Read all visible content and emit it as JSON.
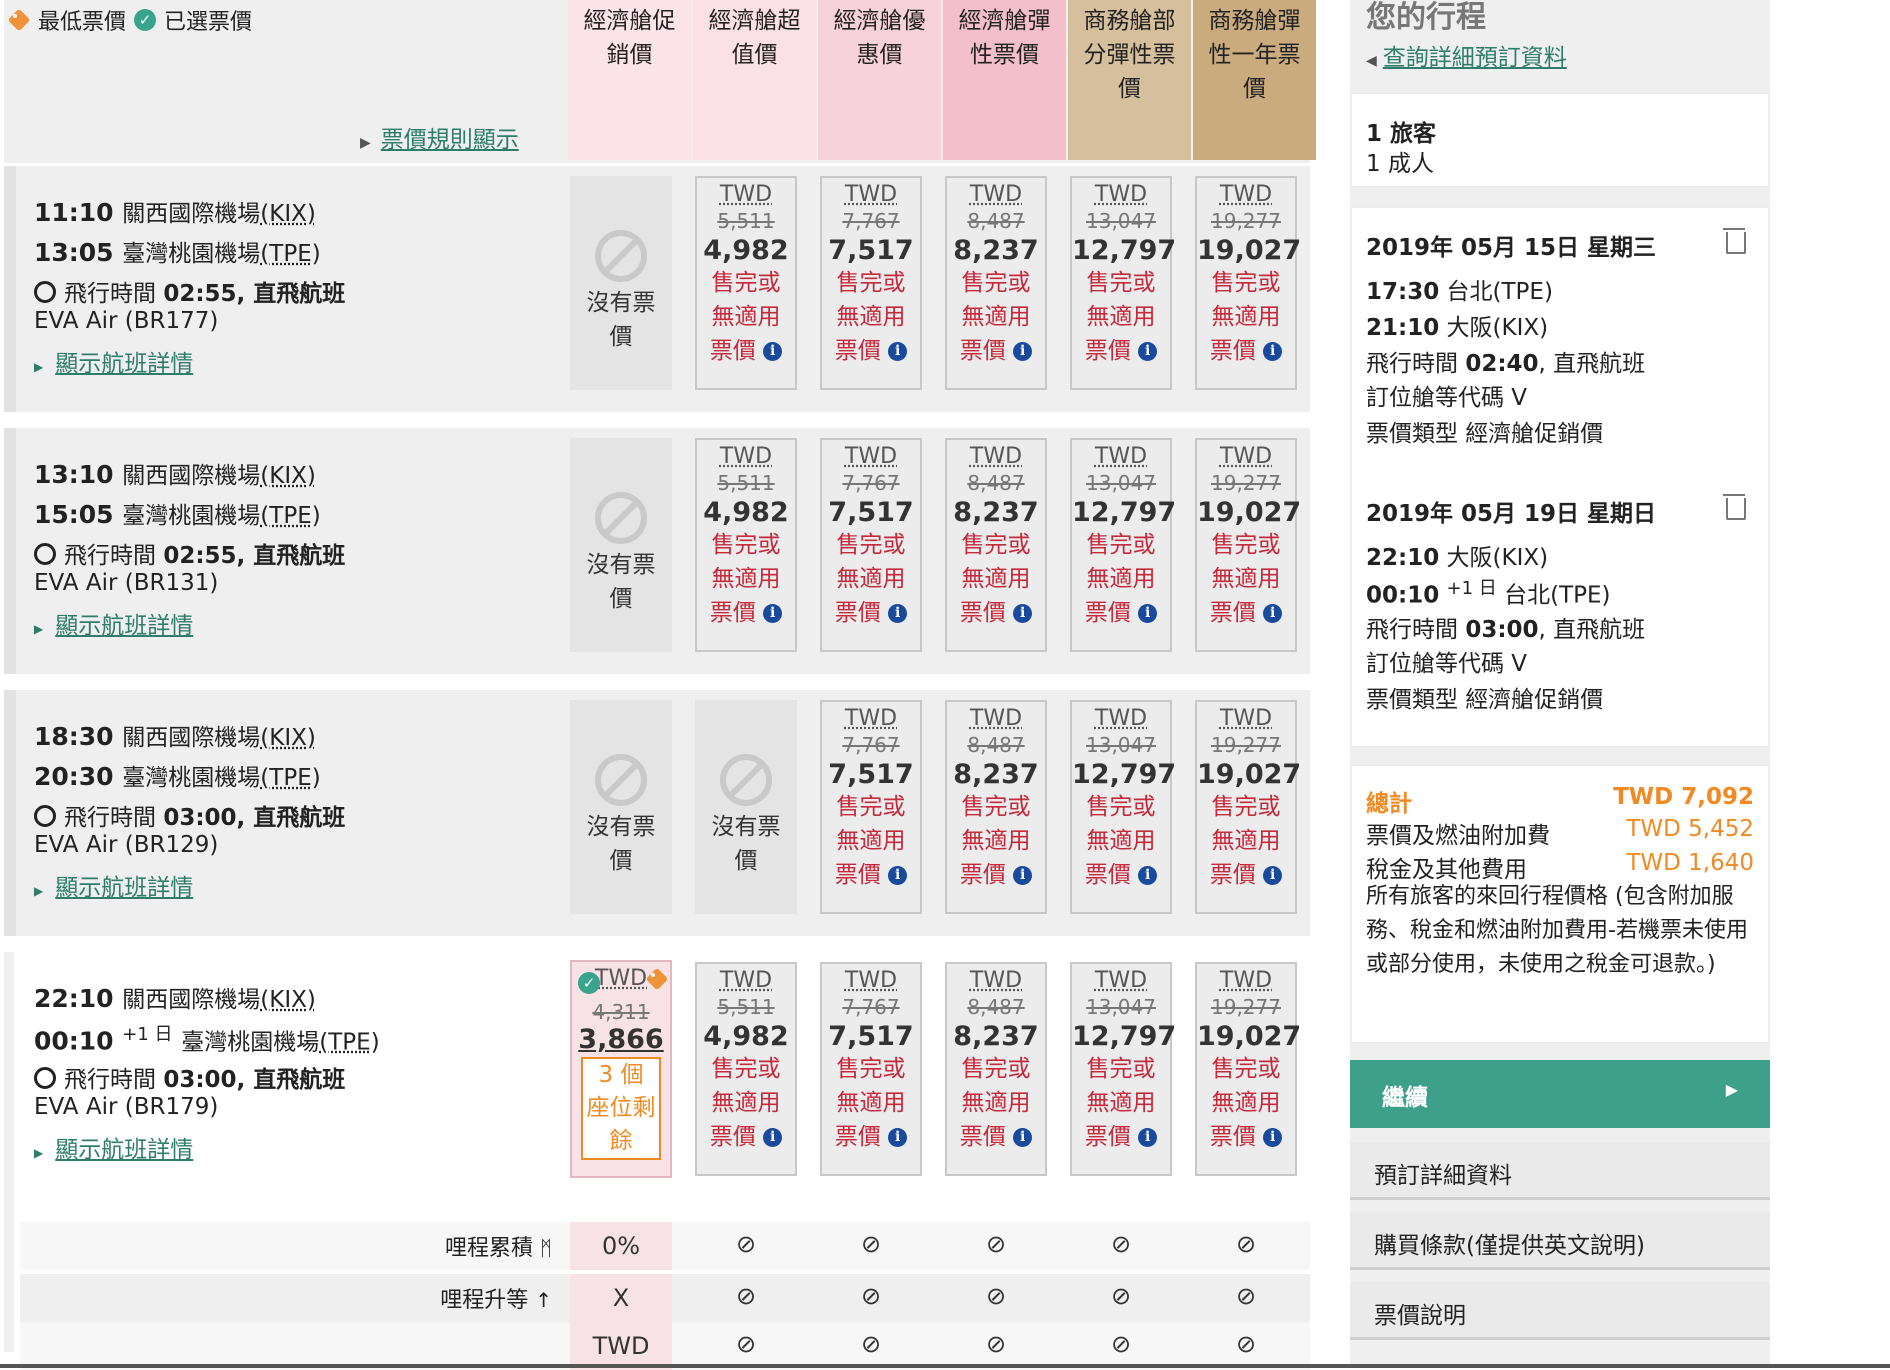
{
  "legend": {
    "lowest": "最低票價",
    "selected": "已選票價"
  },
  "rules_link": "票價規則顯示",
  "columns": [
    {
      "label": "經濟艙促銷價",
      "lines": [
        "經濟艙促",
        "銷價"
      ],
      "color": "#fce4e9"
    },
    {
      "label": "經濟艙超值價",
      "lines": [
        "經濟艙超",
        "值價"
      ],
      "color": "#fbe0e6"
    },
    {
      "label": "經濟艙優惠價",
      "lines": [
        "經濟艙優",
        "惠價"
      ],
      "color": "#f8d2da"
    },
    {
      "label": "經濟艙彈性票價",
      "lines": [
        "經濟艙彈",
        "性票價"
      ],
      "color": "#f3bfcb"
    },
    {
      "label": "商務艙部分彈性票價",
      "lines": [
        "商務艙部",
        "分彈性票",
        "價"
      ],
      "color": "#d6bf9d"
    },
    {
      "label": "商務艙彈性一年票價",
      "lines": [
        "商務艙彈",
        "性一年票",
        "價"
      ],
      "color": "#c9ab7d"
    }
  ],
  "labels": {
    "currency": "TWD",
    "no_price_1": "沒有票",
    "no_price_2": "價",
    "na_1": "售完或",
    "na_2": "無適用",
    "na_3": "票價",
    "duration_prefix": "飛行時間",
    "direct": ", 直飛航班",
    "details": "顯示航班詳情",
    "plus_day": "+1 日",
    "seats_1": "3 個",
    "seats_2": "座位剩",
    "seats_3": "餘"
  },
  "flights": [
    {
      "dep_time": "11:10",
      "dep_airport": "關西國際機場",
      "dep_code": "(KIX)",
      "arr_time": "13:05",
      "arr_airport": "臺灣桃園機場",
      "arr_code": "(TPE)",
      "duration": "02:55",
      "airline": "EVA Air (BR177)",
      "fares": [
        null,
        {
          "old": "5,511",
          "new": "4,982"
        },
        {
          "old": "7,767",
          "new": "7,517"
        },
        {
          "old": "8,487",
          "new": "8,237"
        },
        {
          "old": "13,047",
          "new": "12,797"
        },
        {
          "old": "19,277",
          "new": "19,027"
        }
      ]
    },
    {
      "dep_time": "13:10",
      "dep_airport": "關西國際機場",
      "dep_code": "(KIX)",
      "arr_time": "15:05",
      "arr_airport": "臺灣桃園機場",
      "arr_code": "(TPE)",
      "duration": "02:55",
      "airline": "EVA Air (BR131)",
      "fares": [
        null,
        {
          "old": "5,511",
          "new": "4,982"
        },
        {
          "old": "7,767",
          "new": "7,517"
        },
        {
          "old": "8,487",
          "new": "8,237"
        },
        {
          "old": "13,047",
          "new": "12,797"
        },
        {
          "old": "19,277",
          "new": "19,027"
        }
      ]
    },
    {
      "dep_time": "18:30",
      "dep_airport": "關西國際機場",
      "dep_code": "(KIX)",
      "arr_time": "20:30",
      "arr_airport": "臺灣桃園機場",
      "arr_code": "(TPE)",
      "duration": "03:00",
      "airline": "EVA Air (BR129)",
      "fares": [
        null,
        null,
        {
          "old": "7,767",
          "new": "7,517"
        },
        {
          "old": "8,487",
          "new": "8,237"
        },
        {
          "old": "13,047",
          "new": "12,797"
        },
        {
          "old": "19,277",
          "new": "19,027"
        }
      ]
    },
    {
      "dep_time": "22:10",
      "dep_airport": "關西國際機場",
      "dep_code": "(KIX)",
      "arr_time": "00:10",
      "arr_airport": "臺灣桃園機場",
      "arr_code": "(TPE)",
      "duration": "03:00",
      "airline": "EVA Air (BR179)",
      "selected": {
        "cur": "TWD",
        "old": "4,311",
        "new": "3,866"
      },
      "fares": [
        null,
        {
          "old": "5,511",
          "new": "4,982"
        },
        {
          "old": "7,767",
          "new": "7,517"
        },
        {
          "old": "8,487",
          "new": "8,237"
        },
        {
          "old": "13,047",
          "new": "12,797"
        },
        {
          "old": "19,277",
          "new": "19,027"
        }
      ]
    }
  ],
  "miles": {
    "accrual_label": "哩程累積",
    "upgrade_label": "哩程升等",
    "accrual_first": "0%",
    "upgrade_first": "X",
    "third_first": "TWD",
    "ban": "⊘"
  },
  "itinerary": {
    "title": "您的行程",
    "details_link": "查詢詳細預訂資料",
    "passengers": "1 旅客",
    "adults": "1 成人",
    "segments": [
      {
        "date": "2019年 05月 15日 星期三",
        "dep": "17:30",
        "dep_city": "台北(TPE)",
        "arr": "21:10",
        "arr_city": "大阪(KIX)",
        "plus": "",
        "duration_label": "飛行時間",
        "duration": "02:40",
        "direct": ", 直飛航班",
        "class_label": "訂位艙等代碼 V",
        "fare_type": "票價類型 經濟艙促銷價"
      },
      {
        "date": "2019年 05月 19日 星期日",
        "dep": "22:10",
        "dep_city": "大阪(KIX)",
        "arr": "00:10",
        "arr_city": "台北(TPE)",
        "plus": "+1 日",
        "duration_label": "飛行時間",
        "duration": "03:00",
        "direct": ", 直飛航班",
        "class_label": "訂位艙等代碼 V",
        "fare_type": "票價類型 經濟艙促銷價"
      }
    ],
    "total_label": "總計",
    "total_value": "TWD 7,092",
    "fare_label": "票價及燃油附加費",
    "fare_value": "TWD 5,452",
    "tax_label": "稅金及其他費用",
    "tax_value": "TWD 1,640",
    "note": "所有旅客的來回行程價格 (包含附加服務、稅金和燃油附加費用-若機票未使用或部分使用，未使用之稅金可退款。)",
    "continue": "繼續",
    "buttons": [
      "預訂詳細資料",
      "購買條款(僅提供英文說明)",
      "票價說明"
    ]
  },
  "colors": {
    "teal": "#3e9f8b",
    "orange": "#f08a24",
    "red": "#c42a3c",
    "link": "#2e7d68"
  }
}
